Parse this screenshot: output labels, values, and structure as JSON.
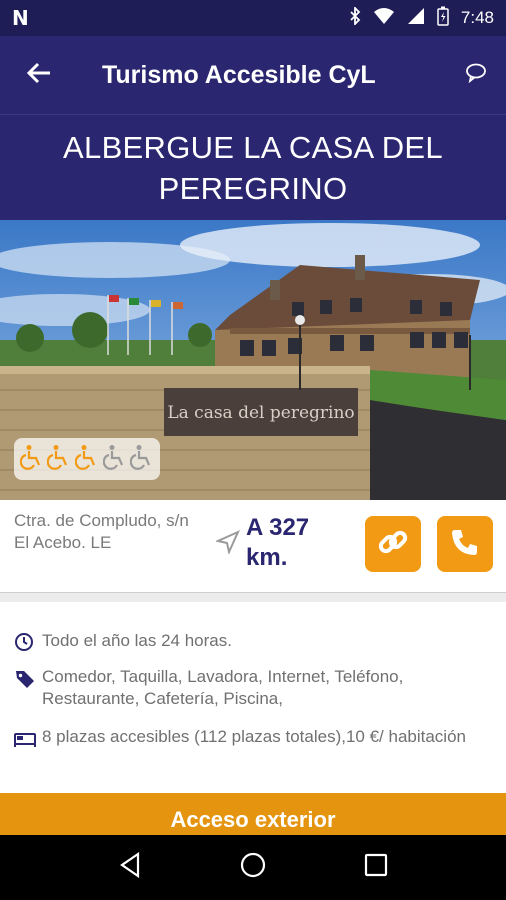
{
  "status_bar": {
    "time": "7:48",
    "notification_icon": "n-icon"
  },
  "app_bar": {
    "title": "Turismo Accesible CyL",
    "back_icon": "arrow-left-icon",
    "chat_icon": "chat-bubble-icon"
  },
  "place": {
    "name": "ALBERGUE LA CASA DEL PEREGRINO"
  },
  "photo": {
    "sign_text": "La casa del peregrino"
  },
  "rating": {
    "accessibility_level": 3,
    "max": 5,
    "active_color": "#f39a14",
    "inactive_color": "#9a9a9a"
  },
  "address": {
    "line1": "Ctra. de Compludo, s/n",
    "line2": "El Acebo. LE"
  },
  "distance": {
    "text": "A 327 km."
  },
  "actions": {
    "link_icon": "link-icon",
    "phone_icon": "phone-icon",
    "color": "#f39a14"
  },
  "details": {
    "hours": "Todo el año las 24 horas.",
    "services": "Comedor, Taquilla, Lavadora, Internet, Teléfono, Restaurante, Cafetería, Piscina,",
    "rooms": "8 plazas accesibles (112 plazas totales),10 €/ habitación"
  },
  "access_section": {
    "label": "Acceso exterior",
    "color": "#e5940f"
  },
  "colors": {
    "primary": "#2a2670",
    "status": "#1f1d56"
  }
}
